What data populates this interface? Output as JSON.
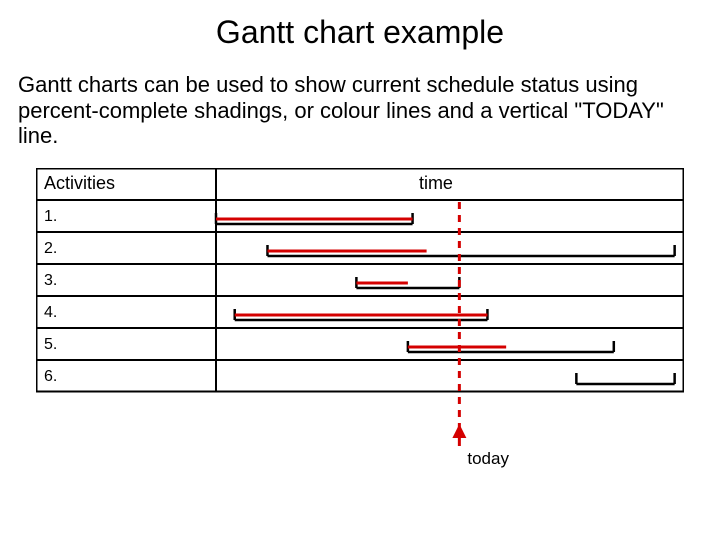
{
  "title": "Gantt chart example",
  "description": "Gantt charts can be used to show current schedule status using percent-complete shadings, or colour lines and a vertical \"TODAY\" line.",
  "today_label": "today",
  "chart_data": {
    "type": "gantt",
    "header_left": "Activities",
    "header_right": "time",
    "x_range": [
      0,
      100
    ],
    "today_x": 52,
    "rows": [
      {
        "label": "1.",
        "bar_start": 0,
        "bar_end": 42,
        "progress_start": 0,
        "progress_end": 42
      },
      {
        "label": "2.",
        "bar_start": 11,
        "bar_end": 98,
        "progress_start": 11,
        "progress_end": 45
      },
      {
        "label": "3.",
        "bar_start": 30,
        "bar_end": 52,
        "progress_start": 30,
        "progress_end": 41
      },
      {
        "label": "4.",
        "bar_start": 4,
        "bar_end": 58,
        "progress_start": 4,
        "progress_end": 58
      },
      {
        "label": "5.",
        "bar_start": 41,
        "bar_end": 85,
        "progress_start": 41,
        "progress_end": 62
      },
      {
        "label": "6.",
        "bar_start": 77,
        "bar_end": 98,
        "progress_start": 0,
        "progress_end": 0
      }
    ]
  }
}
